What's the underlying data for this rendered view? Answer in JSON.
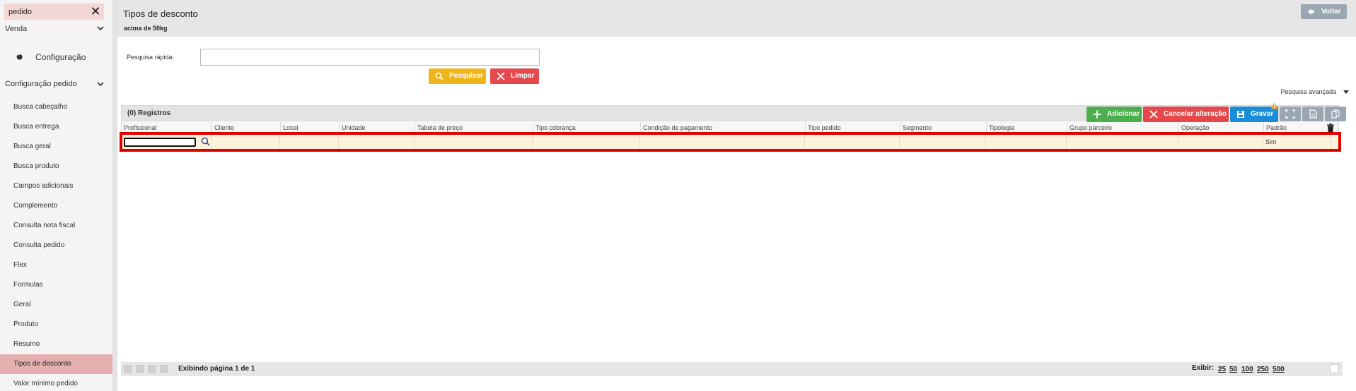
{
  "sidebar": {
    "search": {
      "value": "pedido",
      "placeholder": ""
    },
    "groups": [
      {
        "label": "Venda"
      },
      {
        "label": "Configuração"
      },
      {
        "label": "Configuração pedido"
      }
    ],
    "items": [
      {
        "label": "Busca cabeçalho"
      },
      {
        "label": "Busca entrega"
      },
      {
        "label": "Busca geral"
      },
      {
        "label": "Busca produto"
      },
      {
        "label": "Campos adicionais"
      },
      {
        "label": "Complemento"
      },
      {
        "label": "Consulta nota fiscal"
      },
      {
        "label": "Consulta pedido"
      },
      {
        "label": "Flex"
      },
      {
        "label": "Formulas"
      },
      {
        "label": "Geral"
      },
      {
        "label": "Produto"
      },
      {
        "label": "Resumo"
      },
      {
        "label": "Tipos de desconto"
      },
      {
        "label": "Valor mínimo pedido"
      }
    ],
    "active_item": "Tipos de desconto"
  },
  "header": {
    "title": "Tipos de desconto",
    "subtitle": "acima de 50kg",
    "back_label": "Voltar"
  },
  "filter": {
    "quick_search_label": "Pesquisa rápida:",
    "quick_search_value": "",
    "search_label": "Pesquisar",
    "clear_label": "Limpar",
    "advanced_label": "Pesquisa avançada"
  },
  "grid": {
    "record_count": "(0) Registros",
    "toolbar": {
      "add_label": "Adicionar",
      "cancel_label": "Cancelar alteração",
      "save_label": "Gravar"
    },
    "columns": [
      "Profissional",
      "Cliente",
      "Local",
      "Unidade",
      "Tabela de preço",
      "Tipo cobrança",
      "Condição de pagamento",
      "Tipo pedido",
      "Segmento",
      "Tipologia",
      "Grupo parceiro",
      "Operação",
      "Padrão"
    ],
    "row": {
      "profissional": "",
      "padrao": "Sim"
    }
  },
  "pagination": {
    "info": "Exibindo página 1 de 1",
    "show_label": "Exibir:",
    "sizes": [
      "25",
      "50",
      "100",
      "250",
      "500"
    ]
  },
  "colors": {
    "accent_yellow": "#f0b51a",
    "accent_red": "#e5484b",
    "accent_green": "#4cae4c",
    "accent_blue": "#1b8dd8",
    "highlight": "#e00000",
    "active_nav": "#e6b0b0"
  }
}
